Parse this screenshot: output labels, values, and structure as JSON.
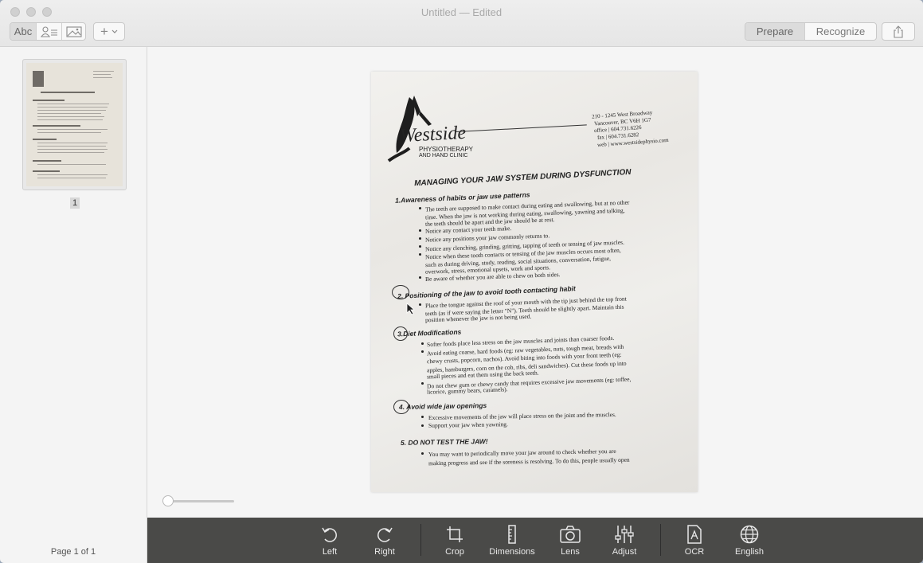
{
  "window": {
    "title": "Untitled — Edited"
  },
  "toolbar": {
    "view_modes": [
      "Abc",
      "contacts-icon",
      "image-icon"
    ],
    "add_label": "+",
    "segments": {
      "prepare": "Prepare",
      "recognize": "Recognize"
    }
  },
  "sidebar": {
    "page_index": "1",
    "page_count_label": "Page 1 of 1"
  },
  "document": {
    "address": [
      "210 - 1245 West Broadway",
      "Vancouver, BC V6H 1G7",
      "office | 604.731.6226",
      "fax | 604.731.6282",
      "web | www.westsidephysio.com"
    ],
    "logo_text": "Westside",
    "logo_sub": [
      "PHYSIOTHERAPY",
      "AND HAND CLINIC"
    ],
    "heading": "MANAGING YOUR JAW SYSTEM DURING DYSFUNCTION",
    "sections": [
      {
        "title": "1.Awareness of habits or jaw use patterns",
        "items": [
          "The teeth are supposed to make contact during eating and swallowing, but at no other",
          "time. When the jaw is not working during eating, swallowing, yawning and talking,",
          "the teeth should be apart and the jaw should be at rest.",
          "Notice any contact your teeth make.",
          "Notice any positions your jaw commonly returns to.",
          "Notice any clenching, grinding, gritting, tapping of teeth or tensing of jaw muscles.",
          "Notice when these tooth contacts or tensing of the jaw muscles occurs most often,",
          "such as during driving, study, reading, social situations, conversation, fatigue,",
          "overwork, stress, emotional upsets, work and sports.",
          "Be aware of whether you are able to chew on both sides."
        ]
      },
      {
        "title": "2. Positioning of the jaw to avoid tooth contacting habit",
        "items": [
          "Place the tongue against the roof of your mouth with the tip just behind the top front",
          "teeth (as if were saying the letter \"N\"). Teeth should be slightly apart. Maintain this",
          "position whenever the jaw is not being used."
        ]
      },
      {
        "title": "3.Diet Modifications",
        "items": [
          "Softer foods place less stress on the jaw muscles and joints than coarser foods.",
          "Avoid eating coarse, hard foods (eg: raw vegetables, nuts, tough meat, breads with",
          "chewy crusts, popcorn, nachos). Avoid biting into foods with your front teeth (eg:",
          "apples, hamburgers, corn on the cob, ribs, deli sandwiches). Cut these foods up into",
          "small pieces and eat them using the back teeth.",
          "Do not chew gum or chewy candy that requires excessive jaw movements (eg: toffee,",
          "licorice, gummy bears, caramels)."
        ]
      },
      {
        "title": "4. Avoid wide jaw openings",
        "items": [
          "Excessive movements of the jaw will place stress on the joint and the muscles.",
          "Support your jaw when yawning."
        ]
      },
      {
        "title": "5. DO NOT TEST THE JAW!",
        "items": [
          "You may want to periodically move your jaw around to check whether you are",
          "making progress and see if the soreness is resolving. To do this, people usually open"
        ]
      }
    ]
  },
  "bottom_tools": [
    {
      "name": "rotate-left",
      "label": "Left"
    },
    {
      "name": "rotate-right",
      "label": "Right"
    },
    {
      "name": "crop",
      "label": "Crop"
    },
    {
      "name": "dimensions",
      "label": "Dimensions"
    },
    {
      "name": "lens",
      "label": "Lens"
    },
    {
      "name": "adjust",
      "label": "Adjust"
    },
    {
      "name": "ocr",
      "label": "OCR"
    },
    {
      "name": "language",
      "label": "English"
    }
  ]
}
